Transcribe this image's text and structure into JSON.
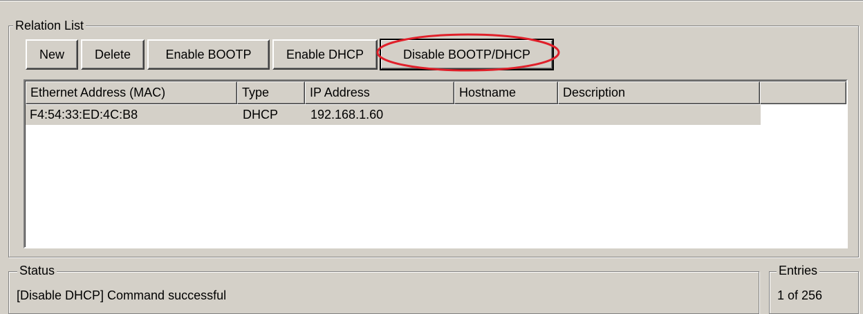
{
  "relation_list": {
    "title": "Relation List",
    "buttons": {
      "new": "New",
      "delete": "Delete",
      "enable_bootp": "Enable BOOTP",
      "enable_dhcp": "Enable DHCP",
      "disable_bootp_dhcp": "Disable BOOTP/DHCP"
    },
    "columns": [
      "Ethernet Address (MAC)",
      "Type",
      "IP Address",
      "Hostname",
      "Description"
    ],
    "rows": [
      {
        "mac": "F4:54:33:ED:4C:B8",
        "type": "DHCP",
        "ip": "192.168.1.60",
        "hostname": "",
        "description": ""
      }
    ]
  },
  "status": {
    "title": "Status",
    "text": "[Disable DHCP] Command successful"
  },
  "entries": {
    "title": "Entries",
    "text": "1 of 256"
  },
  "annotation": {
    "highlight_color": "#e0202a"
  }
}
